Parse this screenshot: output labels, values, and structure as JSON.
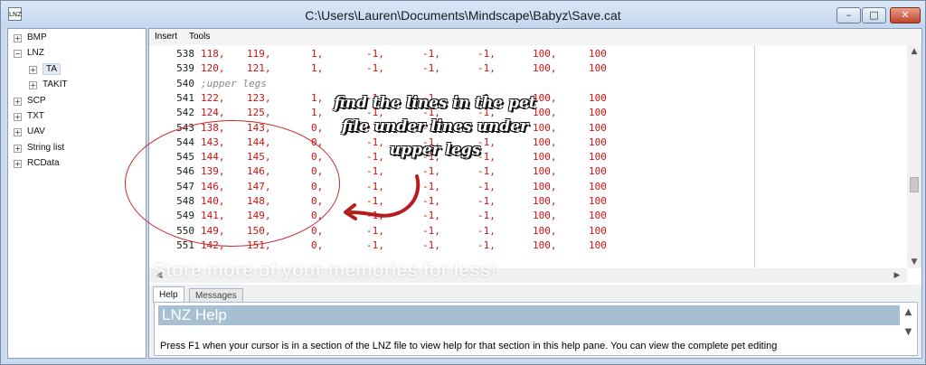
{
  "window": {
    "title": "C:\\Users\\Lauren\\Documents\\Mindscape\\Babyz\\Save.cat",
    "app_icon": "LNZ"
  },
  "tree": {
    "items": [
      {
        "label": "BMP",
        "expander": "+",
        "indent": 0
      },
      {
        "label": "LNZ",
        "expander": "−",
        "indent": 0
      },
      {
        "label": "TA",
        "expander": "+",
        "indent": 1,
        "selected": true
      },
      {
        "label": "TAKIT",
        "expander": "+",
        "indent": 1
      },
      {
        "label": "SCP",
        "expander": "+",
        "indent": 0
      },
      {
        "label": "TXT",
        "expander": "+",
        "indent": 0
      },
      {
        "label": "UAV",
        "expander": "+",
        "indent": 0
      },
      {
        "label": "String list",
        "expander": "+",
        "indent": 0
      },
      {
        "label": "RCData",
        "expander": "+",
        "indent": 0
      }
    ]
  },
  "menu": {
    "items": [
      "Insert",
      "Tools"
    ]
  },
  "editor": {
    "lines": [
      {
        "num": "538",
        "cells": [
          "118,",
          "119,",
          "1,",
          "-1,",
          "-1,",
          "-1,",
          "100,",
          "100"
        ]
      },
      {
        "num": "539",
        "cells": [
          "120,",
          "121,",
          "1,",
          "-1,",
          "-1,",
          "-1,",
          "100,",
          "100"
        ]
      },
      {
        "num": "540",
        "comment": ";upper legs"
      },
      {
        "num": "541",
        "cells": [
          "122,",
          "123,",
          "1,",
          "-1,",
          "-1,",
          "-1,",
          "100,",
          "100"
        ]
      },
      {
        "num": "542",
        "cells": [
          "124,",
          "125,",
          "1,",
          "-1,",
          "-1,",
          "-1,",
          "100,",
          "100"
        ]
      },
      {
        "num": "543",
        "cells": [
          "138,",
          "143,",
          "0,",
          "-1,",
          "-1,",
          "-1,",
          "100,",
          "100"
        ]
      },
      {
        "num": "544",
        "cells": [
          "143,",
          "144,",
          "0,",
          "-1,",
          "-1,",
          "-1,",
          "100,",
          "100"
        ]
      },
      {
        "num": "545",
        "cells": [
          "144,",
          "145,",
          "0,",
          "-1,",
          "-1,",
          "-1,",
          "100,",
          "100"
        ]
      },
      {
        "num": "546",
        "cells": [
          "139,",
          "146,",
          "0,",
          "-1,",
          "-1,",
          "-1,",
          "100,",
          "100"
        ]
      },
      {
        "num": "547",
        "cells": [
          "146,",
          "147,",
          "0,",
          "-1,",
          "-1,",
          "-1,",
          "100,",
          "100"
        ]
      },
      {
        "num": "548",
        "cells": [
          "140,",
          "148,",
          "0,",
          "-1,",
          "-1,",
          "-1,",
          "100,",
          "100"
        ]
      },
      {
        "num": "549",
        "cells": [
          "141,",
          "149,",
          "0,",
          "-1,",
          "-1,",
          "-1,",
          "100,",
          "100"
        ]
      },
      {
        "num": "550",
        "cells": [
          "149,",
          "150,",
          "0,",
          "-1,",
          "-1,",
          "-1,",
          "100,",
          "100"
        ]
      },
      {
        "num": "551",
        "cells": [
          "142,",
          "151,",
          "0,",
          "-1,",
          "-1,",
          "-1,",
          "100,",
          "100"
        ]
      }
    ]
  },
  "help_pane": {
    "tabs": [
      "Help",
      "Messages"
    ],
    "title": "LNZ Help",
    "text": "Press F1 when your cursor is in a section of the LNZ file to view help for that section in this help pane. You can view the complete pet editing"
  },
  "watermark": "Store more of your memories for less!",
  "annotation": {
    "text": "find the lines in the pet file under lines under upper legs",
    "color": "#c62828"
  }
}
